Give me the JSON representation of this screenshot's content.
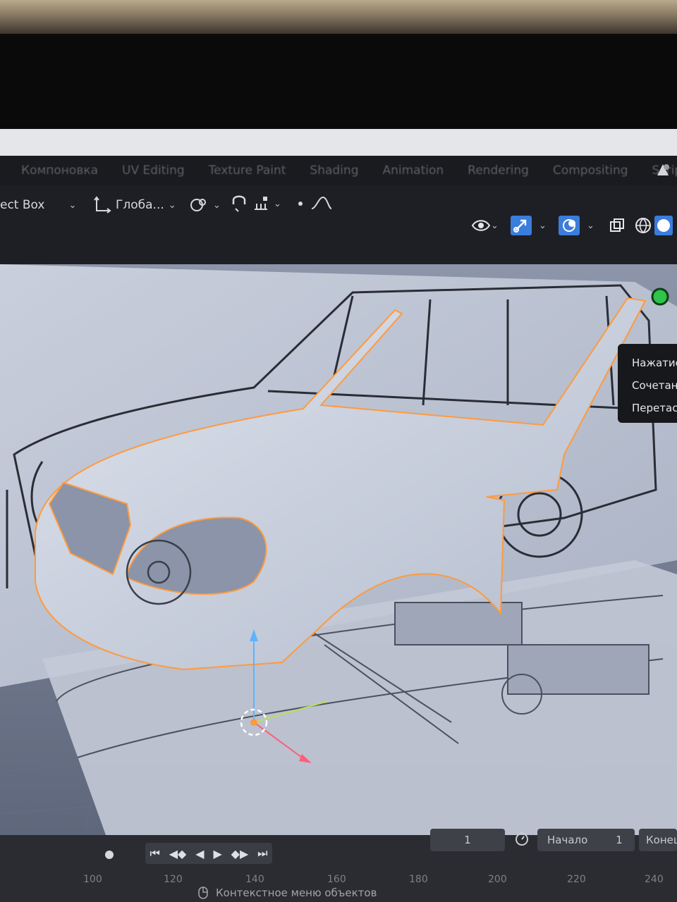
{
  "workspace_tabs": [
    "Компоновка",
    "UV Editing",
    "Texture Paint",
    "Shading",
    "Animation",
    "Rendering",
    "Compositing",
    "Scripting"
  ],
  "toolbar": {
    "select_mode": "ect Box",
    "orientation": "Глоба...",
    "pivot_icon": "pivot-point-icon",
    "snap_icon": "snap-magnet-icon",
    "proportional_icon": "proportional-edit-icon"
  },
  "tooltip": {
    "line1": "Нажатие",
    "line2": "Сочетан",
    "line3": "Перетас"
  },
  "timeline": {
    "current_frame": "1",
    "start_label": "Начало",
    "start_value": "1",
    "end_label": "Конец",
    "ruler": [
      "100",
      "120",
      "140",
      "160",
      "180",
      "200",
      "220",
      "240"
    ]
  },
  "status_bar": {
    "context_menu": "Контекстное меню объектов"
  },
  "colors": {
    "selection_outline": "#ff9a3c",
    "header_bg": "#1e1f24",
    "active_button": "#3b7ddd"
  }
}
